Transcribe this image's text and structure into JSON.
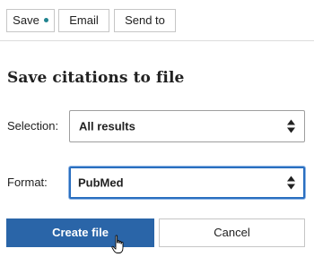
{
  "toolbar": {
    "save_label": "Save",
    "email_label": "Email",
    "send_to_label": "Send to",
    "status_dot_color": "#20838f"
  },
  "panel": {
    "title": "Save citations to file",
    "selection": {
      "label": "Selection:",
      "value": "All results",
      "icon": "up-down-caret-icon"
    },
    "format": {
      "label": "Format:",
      "value": "PubMed",
      "icon": "up-down-caret-icon"
    },
    "create_label": "Create file",
    "cancel_label": "Cancel"
  },
  "colors": {
    "primary": "#2a65a8",
    "focus": "#2a6fc0"
  },
  "cursor": "hand-pointer-icon"
}
